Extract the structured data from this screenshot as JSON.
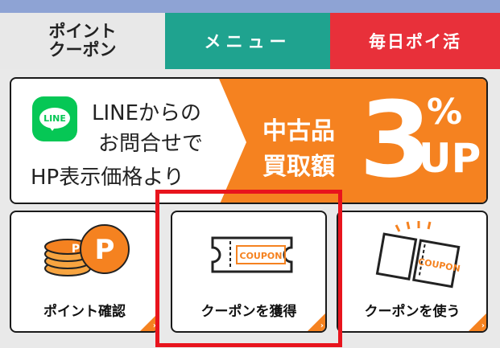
{
  "tabs": {
    "point_coupon_line1": "ポイント",
    "point_coupon_line2": "クーポン",
    "menu": "メニュー",
    "daily": "毎日ポイ活"
  },
  "banner": {
    "line_logo_text": "LINE",
    "line1": "LINEからの",
    "line2": "お問合せで",
    "line3": "HP表示価格より",
    "right1": "中古品",
    "right2": "買取額",
    "big_number": "3",
    "percent": "%",
    "up": "UP"
  },
  "tiles": {
    "point_check": "ポイント確認",
    "coupon_get": "クーポンを獲得",
    "coupon_use": "クーポンを使う",
    "coupon_icon_text": "COUPON",
    "point_icon_text": "P"
  },
  "colors": {
    "tab_menu": "#1fa38f",
    "tab_daily": "#e8303a",
    "orange": "#f58220",
    "line_green": "#06c755",
    "highlight": "#e8141d"
  }
}
